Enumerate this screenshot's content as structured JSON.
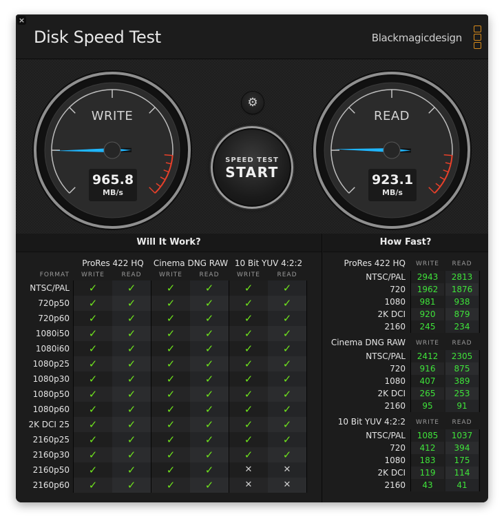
{
  "window": {
    "close_icon": "close-icon",
    "title": "Disk Speed Test",
    "brand": "Blackmagicdesign",
    "brand_logo_color": "#d88b1a"
  },
  "gauges": {
    "write": {
      "label": "WRITE",
      "value": "965.8",
      "unit": "MB/s",
      "needle_color": "#1fb6ff"
    },
    "read": {
      "label": "READ",
      "value": "923.1",
      "unit": "MB/s",
      "needle_color": "#1fb6ff"
    },
    "redzone_color": "#e8402a"
  },
  "controls": {
    "settings_icon": "gear-icon",
    "start_top": "SPEED TEST",
    "start_main": "START"
  },
  "will_it_work": {
    "title": "Will It Work?",
    "format_header": "FORMAT",
    "codecs": [
      "ProRes 422 HQ",
      "Cinema DNG RAW",
      "10 Bit YUV 4:2:2"
    ],
    "col_write": "WRITE",
    "col_read": "READ",
    "ok_symbol": "✓",
    "fail_symbol": "✕",
    "ok_color": "#6fe31d",
    "rows": [
      {
        "format": "NTSC/PAL",
        "results": [
          true,
          true,
          true,
          true,
          true,
          true
        ]
      },
      {
        "format": "720p50",
        "results": [
          true,
          true,
          true,
          true,
          true,
          true
        ]
      },
      {
        "format": "720p60",
        "results": [
          true,
          true,
          true,
          true,
          true,
          true
        ]
      },
      {
        "format": "1080i50",
        "results": [
          true,
          true,
          true,
          true,
          true,
          true
        ]
      },
      {
        "format": "1080i60",
        "results": [
          true,
          true,
          true,
          true,
          true,
          true
        ]
      },
      {
        "format": "1080p25",
        "results": [
          true,
          true,
          true,
          true,
          true,
          true
        ]
      },
      {
        "format": "1080p30",
        "results": [
          true,
          true,
          true,
          true,
          true,
          true
        ]
      },
      {
        "format": "1080p50",
        "results": [
          true,
          true,
          true,
          true,
          true,
          true
        ]
      },
      {
        "format": "1080p60",
        "results": [
          true,
          true,
          true,
          true,
          true,
          true
        ]
      },
      {
        "format": "2K DCI 25",
        "results": [
          true,
          true,
          true,
          true,
          true,
          true
        ]
      },
      {
        "format": "2160p25",
        "results": [
          true,
          true,
          true,
          true,
          true,
          true
        ]
      },
      {
        "format": "2160p30",
        "results": [
          true,
          true,
          true,
          true,
          true,
          true
        ]
      },
      {
        "format": "2160p50",
        "results": [
          true,
          true,
          true,
          true,
          false,
          false
        ]
      },
      {
        "format": "2160p60",
        "results": [
          true,
          true,
          true,
          true,
          false,
          false
        ]
      }
    ]
  },
  "how_fast": {
    "title": "How Fast?",
    "col_write": "WRITE",
    "col_read": "READ",
    "value_color": "#3fe43a",
    "groups": [
      {
        "codec": "ProRes 422 HQ",
        "rows": [
          {
            "format": "NTSC/PAL",
            "write": "2943",
            "read": "2813"
          },
          {
            "format": "720",
            "write": "1962",
            "read": "1876"
          },
          {
            "format": "1080",
            "write": "981",
            "read": "938"
          },
          {
            "format": "2K DCI",
            "write": "920",
            "read": "879"
          },
          {
            "format": "2160",
            "write": "245",
            "read": "234"
          }
        ]
      },
      {
        "codec": "Cinema DNG RAW",
        "rows": [
          {
            "format": "NTSC/PAL",
            "write": "2412",
            "read": "2305"
          },
          {
            "format": "720",
            "write": "916",
            "read": "875"
          },
          {
            "format": "1080",
            "write": "407",
            "read": "389"
          },
          {
            "format": "2K DCI",
            "write": "265",
            "read": "253"
          },
          {
            "format": "2160",
            "write": "95",
            "read": "91"
          }
        ]
      },
      {
        "codec": "10 Bit YUV 4:2:2",
        "rows": [
          {
            "format": "NTSC/PAL",
            "write": "1085",
            "read": "1037"
          },
          {
            "format": "720",
            "write": "412",
            "read": "394"
          },
          {
            "format": "1080",
            "write": "183",
            "read": "175"
          },
          {
            "format": "2K DCI",
            "write": "119",
            "read": "114"
          },
          {
            "format": "2160",
            "write": "43",
            "read": "41"
          }
        ]
      }
    ]
  }
}
